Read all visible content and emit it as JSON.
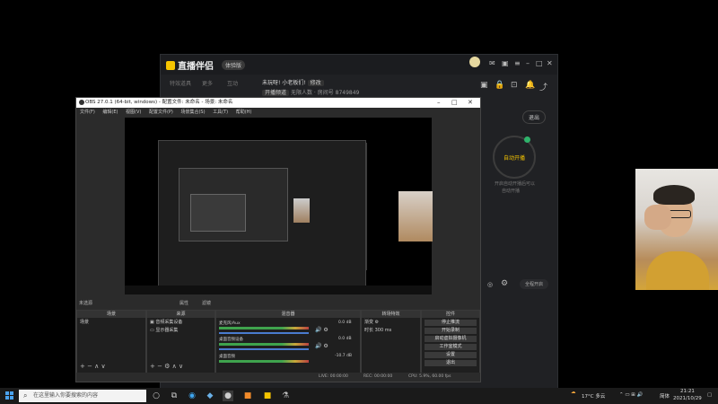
{
  "assistant": {
    "logo": "直播伴侣",
    "badge": "体验版",
    "nav": [
      "特效道具",
      "更多",
      "互动"
    ],
    "title": "未玩呀! 小老板们!",
    "edit_label": "修改",
    "category_tag": "开播频道",
    "sub_tag": "无限人数",
    "room": "房间号",
    "room_id": "8749849",
    "settings_button": "退出",
    "start_label": "自动开播",
    "status_lines": [
      "开启自动开播后可以",
      "自动开播"
    ],
    "bottom_label": "全程开启"
  },
  "obs": {
    "title": "OBS 27.0.1 (64-bit, windows) - 配置文件: 未命名 - 场景: 未命名",
    "menus": [
      "文件(F)",
      "编辑(E)",
      "视图(V)",
      "配置文件(P)",
      "场景集合(S)",
      "工具(T)",
      "帮助(H)"
    ],
    "status_left": "未选源",
    "status_props": "属性",
    "status_filters": "滤镜",
    "docks": {
      "scenes": {
        "title": "场景",
        "items": [
          "场景"
        ]
      },
      "sources": {
        "title": "来源",
        "items": [
          "音频采集设备",
          "显示器采集"
        ]
      },
      "mixer": {
        "title": "混音器",
        "channels": [
          {
            "name": "麦克风/Aux",
            "db": "0.0 dB"
          },
          {
            "name": "桌面音频设备",
            "db": "0.0 dB"
          },
          {
            "name": "桌面音频",
            "db": "-10.7 dB"
          }
        ]
      },
      "transitions": {
        "title": "转场特效",
        "type": "渐变",
        "duration_label": "时长",
        "duration": "300 ms"
      },
      "controls": {
        "title": "控件",
        "buttons": [
          "停止推流",
          "开始录制",
          "启动虚拟摄像机",
          "工作室模式",
          "设置",
          "退出"
        ]
      }
    },
    "status": {
      "live": "LIVE: 00:00:00",
      "rec": "REC: 00:00:00",
      "cpu": "CPU: 5.9%, 60.00 fps"
    }
  },
  "taskbar": {
    "search_placeholder": "在这里输入你要搜索的内容",
    "weather": "17°C 多云",
    "ime": "简体",
    "time": "21:21",
    "date": "2021/10/29"
  }
}
